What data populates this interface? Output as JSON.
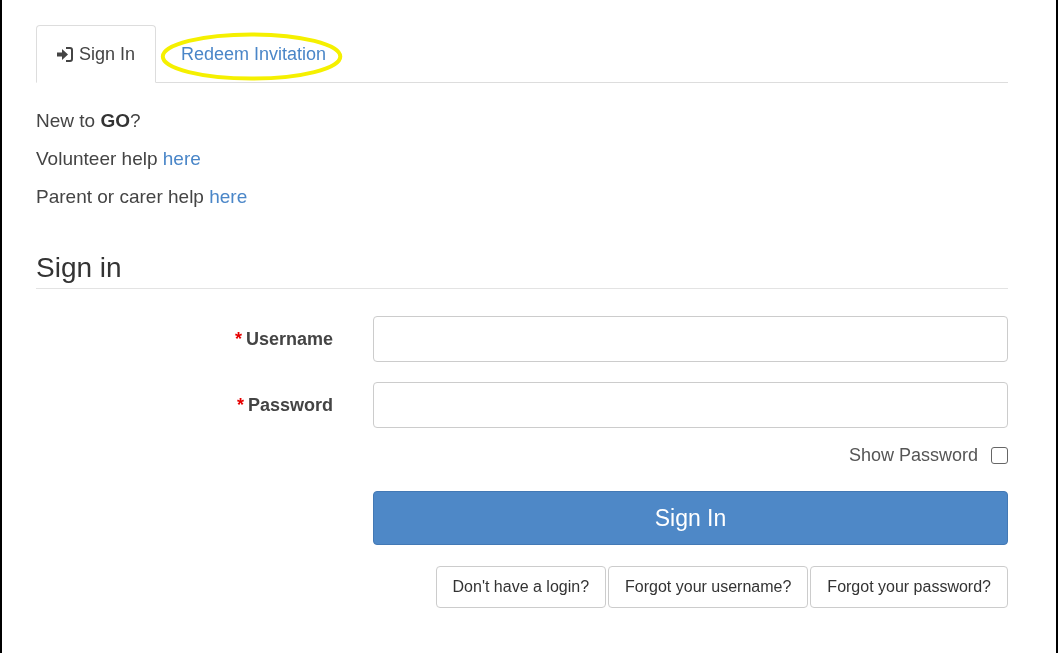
{
  "tabs": [
    {
      "label": "Sign In",
      "icon": true,
      "selected": true,
      "highlighted": false
    },
    {
      "label": "Redeem Invitation",
      "icon": false,
      "selected": false,
      "highlighted": true
    }
  ],
  "help": [
    {
      "text": "New to **GO**?"
    },
    {
      "text": "Volunteer help",
      "link": "here"
    },
    {
      "text": "Parent or carer help",
      "link": "here"
    }
  ],
  "form": {
    "title": "Sign in",
    "fields": [
      {
        "required_mark": "*",
        "label": "Username"
      },
      {
        "required_mark": "*",
        "label": "Password"
      }
    ],
    "show_password": {
      "label": "Show Password",
      "checked": false
    },
    "submit": "Sign In",
    "links": [
      "Don't have a login?",
      "Forgot your username?",
      "Forgot your password?"
    ]
  }
}
